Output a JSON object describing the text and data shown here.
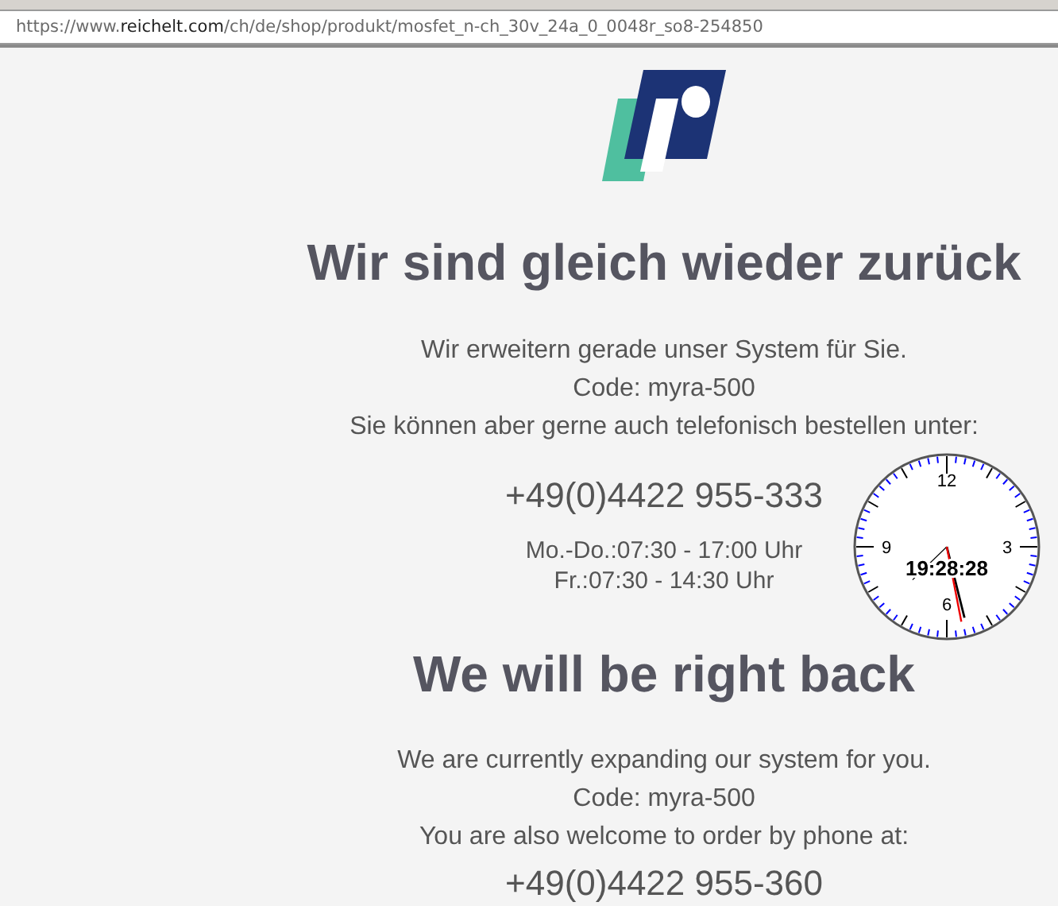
{
  "address_bar": {
    "scheme": "https://www.",
    "host": "reichelt.com",
    "path": "/ch/de/shop/produkt/mosfet_n-ch_30v_24a_0_0048r_so8-254850"
  },
  "sections": [
    {
      "title": "Wir sind gleich wieder zurück",
      "lines": [
        "Wir erweitern gerade unser System für Sie.",
        "Code: myra-500",
        "Sie können aber gerne auch telefonisch bestellen unter:"
      ],
      "phone": "+49(0)4422 955-333",
      "hours": [
        "Mo.-Do.:07:30 - 17:00 Uhr",
        "Fr.:07:30 - 14:30 Uhr"
      ]
    },
    {
      "title": "We will be right back",
      "lines": [
        "We are currently expanding our system for you.",
        "Code: myra-500",
        "You are also welcome to order by phone at:"
      ],
      "phone": "+49(0)4422 955-360"
    }
  ],
  "clock": {
    "time": "19:28:28",
    "numerals": [
      "12",
      "3",
      "6",
      "9"
    ]
  }
}
